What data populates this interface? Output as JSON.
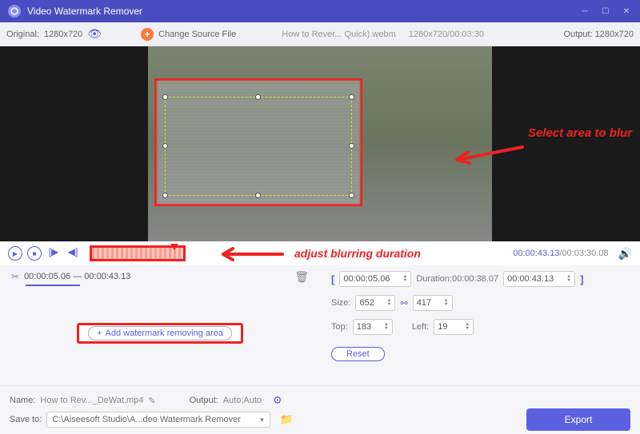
{
  "titlebar": {
    "title": "Video Watermark Remover"
  },
  "toolbar": {
    "original_label": "Original:",
    "original_res": "1280x720",
    "change_source": "Change Source File",
    "filename": "How to Rever... Quick).webm",
    "res_dur": "1280x720/00:03:30",
    "output_label": "Output:",
    "output_res": "1280x720"
  },
  "annotations": {
    "select_area": "Select area to blur",
    "adjust_duration": "adjust blurring duration"
  },
  "controls": {
    "current_time": "00:00:43.13",
    "total_time": "00:03:30.08"
  },
  "segment": {
    "range": "00:00:05.06 — 00:00:43.13"
  },
  "params": {
    "start": "00:00:05.06",
    "duration_label": "Duration:",
    "duration": "00:00:38.07",
    "end": "00:00:43.13",
    "size_label": "Size:",
    "width": "652",
    "height": "417",
    "top_label": "Top:",
    "top": "183",
    "left_label": "Left:",
    "left": "19",
    "reset": "Reset"
  },
  "add_area": "Add watermark removing area",
  "bottom": {
    "name_label": "Name:",
    "name_value": "How to Rev..._DeWat.mp4",
    "output_label": "Output:",
    "output_value": "Auto;Auto",
    "save_label": "Save to:",
    "save_path": "C:\\Aiseesoft Studio\\A...deo Watermark Remover",
    "export": "Export"
  }
}
